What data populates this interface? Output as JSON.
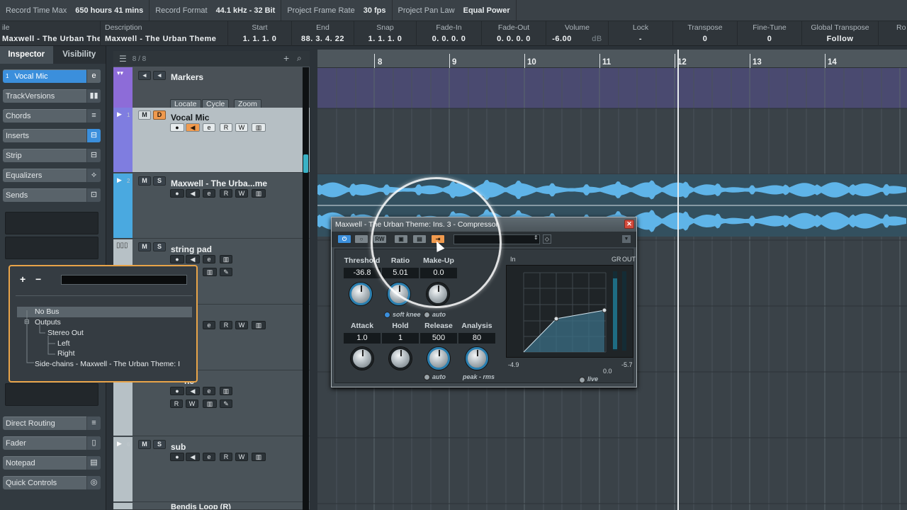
{
  "statusbar": {
    "items": [
      {
        "key": "Record Time Max",
        "val": "650 hours 41 mins"
      },
      {
        "key": "Record Format",
        "val": "44.1 kHz - 32 Bit"
      },
      {
        "key": "Project Frame Rate",
        "val": "30 fps"
      },
      {
        "key": "Project Pan Law",
        "val": "Equal Power"
      }
    ]
  },
  "infoline": {
    "file_head": "ile",
    "file_val": "Maxwell - The Urban Theme",
    "desc_head": "Description",
    "desc_val": "Maxwell - The Urban Theme",
    "start_head": "Start",
    "start_val": "1. 1. 1.   0",
    "end_head": "End",
    "end_val": "88. 3. 4. 22",
    "snap_head": "Snap",
    "snap_val": "1. 1. 1.   0",
    "fadein_head": "Fade-In",
    "fadein_val": "0. 0. 0.   0",
    "fadeout_head": "Fade-Out",
    "fadeout_val": "0. 0. 0.   0",
    "volume_head": "Volume",
    "volume_val": "-6.00",
    "volume_unit": "dB",
    "lock_head": "Lock",
    "lock_val": "-",
    "transpose_head": "Transpose",
    "transpose_val": "0",
    "finetune_head": "Fine-Tune",
    "finetune_val": "0",
    "gtranspose_head": "Global Transpose",
    "gtranspose_val": "Follow",
    "extra_head": "Ro"
  },
  "inspector": {
    "tabs": [
      "Inspector",
      "Visibility"
    ],
    "track_num": "1",
    "track_name": "Vocal Mic",
    "rows": [
      "TrackVersions",
      "Chords",
      "Inserts",
      "Strip",
      "Equalizers",
      "Sends"
    ],
    "bottom_rows": [
      "Direct Routing",
      "Fader",
      "Notepad",
      "Quick Controls"
    ]
  },
  "tracklist": {
    "count": "8 / 8",
    "tracks": [
      {
        "num": "",
        "name": "Markers",
        "buttons": [
          "Locate",
          "Cycle",
          "Zoom"
        ]
      },
      {
        "num": "1",
        "name": "Vocal Mic"
      },
      {
        "num": "2",
        "name": "Maxwell - The Urba...me"
      },
      {
        "num": "3",
        "name": "string pad"
      },
      {
        "num": "",
        "name": ""
      },
      {
        "num": "",
        "name": "ne"
      },
      {
        "num": "6",
        "name": "sub"
      },
      {
        "num": "7",
        "name": "Bendis Loop (R)"
      }
    ]
  },
  "ruler": {
    "bars": [
      "8",
      "9",
      "10",
      "11",
      "12",
      "13",
      "14"
    ]
  },
  "routing": {
    "plus": "+",
    "minus": "−",
    "items": [
      {
        "label": "No Bus"
      },
      {
        "label": "Outputs"
      },
      {
        "label": "Stereo Out"
      },
      {
        "label": "Left"
      },
      {
        "label": "Right"
      },
      {
        "label": "Side-chains - Maxwell - The Urban Theme: I"
      }
    ]
  },
  "compressor": {
    "title": "Maxwell - The Urban Theme: Ins. 3 - Compressor",
    "params_top": [
      {
        "label": "Threshold",
        "value": "-36.8"
      },
      {
        "label": "Ratio",
        "value": "5.01"
      },
      {
        "label": "Make-Up",
        "value": "0.0"
      }
    ],
    "params_bottom": [
      {
        "label": "Attack",
        "value": "1.0"
      },
      {
        "label": "Hold",
        "value": "1"
      },
      {
        "label": "Release",
        "value": "500"
      },
      {
        "label": "Analysis",
        "value": "80"
      }
    ],
    "soft_knee": "soft knee",
    "auto_top": "auto",
    "auto_bottom": "auto",
    "peak_rms": "peak - rms",
    "live": "live",
    "graph_left": "-4.9",
    "graph_mid": "0.0",
    "graph_right": "-5.7",
    "graph_top_a": "In",
    "graph_top_b": "GR",
    "graph_top_c": "OUT"
  },
  "colors": {
    "accent": "#3b8fdc",
    "popup_border": "#e8a449",
    "waveform": "#5fb4e8"
  }
}
